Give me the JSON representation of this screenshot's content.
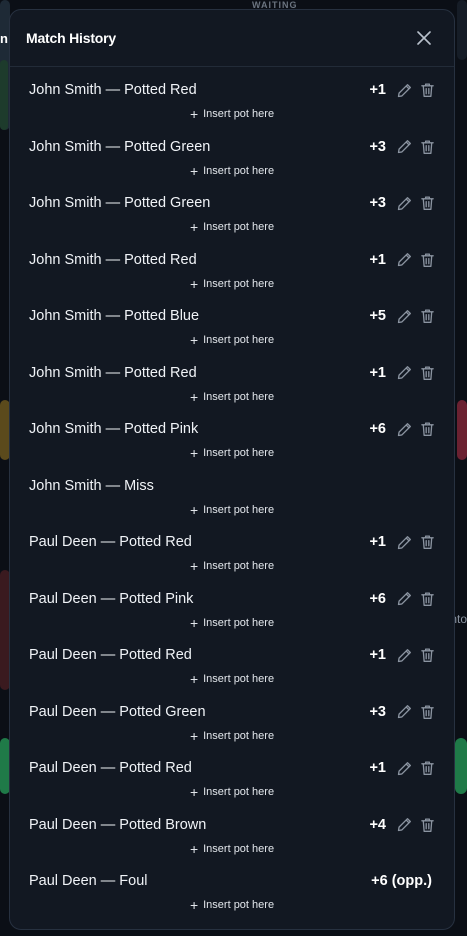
{
  "background": {
    "waiting_label": "WAITING",
    "left_peek": "n",
    "right_peek": "nto"
  },
  "modal": {
    "title": "Match History",
    "insert_label": "Insert pot here",
    "entries": [
      {
        "text": "John Smith — Potted Red",
        "points": "+1",
        "editable": true
      },
      {
        "text": "John Smith — Potted Green",
        "points": "+3",
        "editable": true
      },
      {
        "text": "John Smith — Potted Green",
        "points": "+3",
        "editable": true
      },
      {
        "text": "John Smith — Potted Red",
        "points": "+1",
        "editable": true
      },
      {
        "text": "John Smith — Potted Blue",
        "points": "+5",
        "editable": true
      },
      {
        "text": "John Smith — Potted Red",
        "points": "+1",
        "editable": true
      },
      {
        "text": "John Smith — Potted Pink",
        "points": "+6",
        "editable": true
      },
      {
        "text": "John Smith — Miss",
        "points": "",
        "editable": false
      },
      {
        "text": "Paul Deen — Potted Red",
        "points": "+1",
        "editable": true
      },
      {
        "text": "Paul Deen — Potted Pink",
        "points": "+6",
        "editable": true
      },
      {
        "text": "Paul Deen — Potted Red",
        "points": "+1",
        "editable": true
      },
      {
        "text": "Paul Deen — Potted Green",
        "points": "+3",
        "editable": true
      },
      {
        "text": "Paul Deen — Potted Red",
        "points": "+1",
        "editable": true
      },
      {
        "text": "Paul Deen — Potted Brown",
        "points": "+4",
        "editable": true
      },
      {
        "text": "Paul Deen — Foul",
        "points": "+6 (opp.)",
        "editable": false
      }
    ]
  },
  "colors": {
    "modal_bg": "#121822",
    "text": "#f0f3f7",
    "icon": "#8b94a1"
  }
}
